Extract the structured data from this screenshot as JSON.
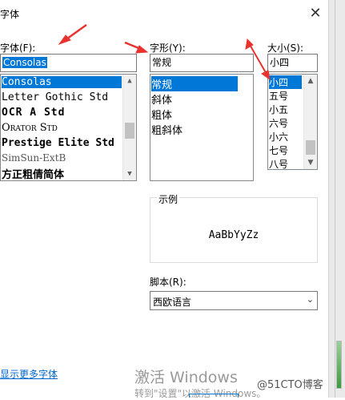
{
  "window": {
    "title": "字体",
    "close_glyph": "✕"
  },
  "font": {
    "label": "字体(F):",
    "input_value": "Consolas",
    "items": [
      "Consolas",
      "Letter Gothic Std",
      "OCR A Std",
      "Orator Std",
      "Prestige Elite Std",
      "SimSun-ExtB",
      "方正粗倩简体"
    ],
    "selected_index": 0
  },
  "style": {
    "label": "字形(Y):",
    "input_value": "常规",
    "items": [
      "常规",
      "斜体",
      "粗体",
      "粗斜体"
    ],
    "selected_index": 0
  },
  "size": {
    "label": "大小(S):",
    "input_value": "小四",
    "items": [
      "小四",
      "五号",
      "小五",
      "六号",
      "小六",
      "七号",
      "八号"
    ],
    "selected_index": 0
  },
  "sample": {
    "label": "示例",
    "text": "AaBbYyZz"
  },
  "script": {
    "label": "脚本(R):",
    "value": "西欧语言"
  },
  "show_more_fonts": "显示更多字体",
  "watermark": {
    "line1": "激活 Windows",
    "line2": "转到\"设置\"以激活 Windows。",
    "brand": "@51CTO博客"
  },
  "colors": {
    "selection": "#0078d7",
    "arrow": "#e8332e",
    "link": "#0066cc"
  },
  "icons": {
    "close": "close-icon",
    "scroll_up": "chevron-up-icon",
    "scroll_down": "chevron-down-icon",
    "dropdown": "chevron-down-icon",
    "annotation": "red-arrow-icon"
  }
}
